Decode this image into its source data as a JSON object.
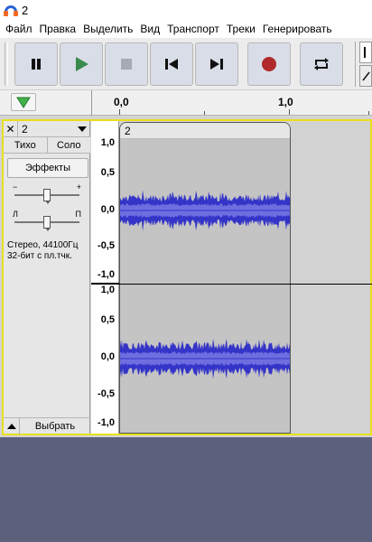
{
  "window": {
    "title": "2"
  },
  "menu": [
    "Файл",
    "Правка",
    "Выделить",
    "Вид",
    "Транспорт",
    "Треки",
    "Генерировать"
  ],
  "transport": {
    "buttons": [
      "pause-icon",
      "play-icon",
      "stop-icon",
      "skip-start-icon",
      "skip-end-icon",
      "record-icon",
      "loop-icon"
    ],
    "colors": {
      "play": "#3b8a4e",
      "record": "#b0292b",
      "button_bg": "#d9dde8"
    }
  },
  "timeline": {
    "labels": [
      "0,0",
      "1,0"
    ]
  },
  "track": {
    "name": "2",
    "mute_label": "Тихо",
    "solo_label": "Соло",
    "effects_label": "Эффекты",
    "gain_minus": "−",
    "gain_plus": "+",
    "pan_left": "Л",
    "pan_right": "П",
    "info_line1": "Стерео, 44100Гц",
    "info_line2": "32-бит с пл.тчк.",
    "select_label": "Выбрать",
    "clip_name": "2"
  },
  "vruler": {
    "channel1": [
      "1,0",
      "0,5",
      "0,0",
      "-0,5",
      "-1,0"
    ],
    "channel2": [
      "1,0",
      "0,5",
      "0,0",
      "-0,5",
      "-1,0"
    ]
  },
  "colors": {
    "waveform": "#3434c8",
    "waveform_rms": "#6f6ee0",
    "selection_border": "#e8df1c"
  }
}
